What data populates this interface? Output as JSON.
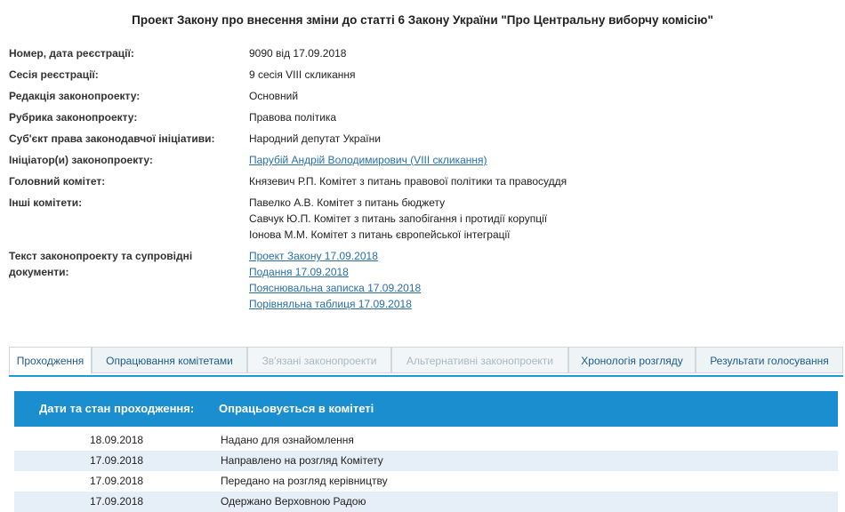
{
  "title": "Проект Закону про внесення зміни до статті 6 Закону України \"Про Центральну виборчу комісію\"",
  "info": {
    "number_label": "Номер, дата реєстрації:",
    "number_value": "9090 від 17.09.2018",
    "session_label": "Сесія реєстрації:",
    "session_value": "9 сесія VIII скликання",
    "edition_label": "Редакція законопроекту:",
    "edition_value": "Основний",
    "rubric_label": "Рубрика законопроекту:",
    "rubric_value": "Правова політика",
    "subject_label": "Суб'єкт права законодавчої ініціативи:",
    "subject_value": "Народний депутат України",
    "initiator_label": "Ініціатор(и) законопроекту:",
    "initiator_value": "Парубій Андрій Володимирович (VIII скликання)",
    "main_committee_label": "Головний комітет:",
    "main_committee_value": "Князевич Р.П. Комітет з питань правової політики та правосуддя",
    "other_committees_label": "Інші комітети:",
    "other_committees": [
      "Павелко А.В. Комітет з питань бюджету",
      "Савчук Ю.П. Комітет з питань запобігання і протидії корупції",
      "Іонова М.М. Комітет з питань європейської інтеграції"
    ],
    "documents_label": "Текст законопроекту та супровідні документи:",
    "documents": [
      "Проект Закону 17.09.2018",
      "Подання 17.09.2018",
      "Пояснювальна записка 17.09.2018",
      "Порівняльна таблиця 17.09.2018"
    ]
  },
  "tabs": [
    {
      "label": "Проходження",
      "state": "active"
    },
    {
      "label": "Опрацювання комітетами",
      "state": "normal"
    },
    {
      "label": "Зв'язані законопроекти",
      "state": "disabled"
    },
    {
      "label": "Альтернативні законопроекти",
      "state": "disabled"
    },
    {
      "label": "Хронологія розгляду",
      "state": "normal"
    },
    {
      "label": "Результати голосування",
      "state": "normal"
    }
  ],
  "passage": {
    "header_dates": "Дати та стан проходження:",
    "header_status": "Опрацьовується в комітеті",
    "rows": [
      {
        "date": "18.09.2018",
        "status": "Надано для ознайомлення"
      },
      {
        "date": "17.09.2018",
        "status": "Направлено на розгляд Комітету"
      },
      {
        "date": "17.09.2018",
        "status": "Передано на розгляд керівництву"
      },
      {
        "date": "17.09.2018",
        "status": "Одержано Верховною Радою"
      }
    ]
  }
}
